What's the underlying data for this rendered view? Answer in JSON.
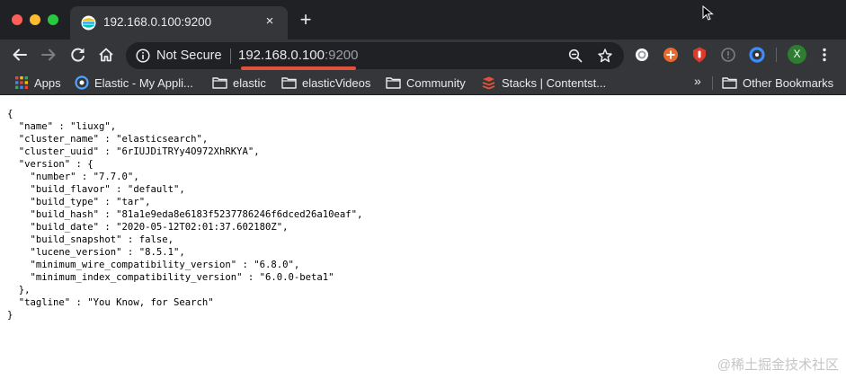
{
  "window": {
    "tab_title": "192.168.0.100:9200",
    "tab_close": "×",
    "new_tab": "+"
  },
  "toolbar": {
    "security_label": "Not Secure",
    "url_host": "192.168.0.100",
    "url_port": ":9200",
    "profile_initial": "X"
  },
  "bookmarks": {
    "items": [
      {
        "label": "Apps",
        "icon": "apps-grid-icon"
      },
      {
        "label": "Elastic - My Appli...",
        "icon": "elastic-globe-icon"
      },
      {
        "label": "elastic",
        "icon": "folder-icon"
      },
      {
        "label": "elasticVideos",
        "icon": "folder-icon"
      },
      {
        "label": "Community",
        "icon": "folder-icon"
      },
      {
        "label": "Stacks | Contentst...",
        "icon": "contentstack-icon"
      }
    ],
    "overflow": "»",
    "other_bookmarks": "Other Bookmarks"
  },
  "page": {
    "lines": [
      "{",
      "  \"name\" : \"liuxg\",",
      "  \"cluster_name\" : \"elasticsearch\",",
      "  \"cluster_uuid\" : \"6rIUJDiTRYy4O972XhRKYA\",",
      "  \"version\" : {",
      "    \"number\" : \"7.7.0\",",
      "    \"build_flavor\" : \"default\",",
      "    \"build_type\" : \"tar\",",
      "    \"build_hash\" : \"81a1e9eda8e6183f5237786246f6dced26a10eaf\",",
      "    \"build_date\" : \"2020-05-12T02:01:37.602180Z\",",
      "    \"build_snapshot\" : false,",
      "    \"lucene_version\" : \"8.5.1\",",
      "    \"minimum_wire_compatibility_version\" : \"6.8.0\",",
      "    \"minimum_index_compatibility_version\" : \"6.0.0-beta1\"",
      "  },",
      "  \"tagline\" : \"You Know, for Search\"",
      "}"
    ]
  },
  "watermark": "@稀土掘金技术社区",
  "colors": {
    "tabstrip": "#202124",
    "toolbar": "#35363a",
    "url_underline": "#e0523c",
    "avatar": "#2e7d32"
  }
}
